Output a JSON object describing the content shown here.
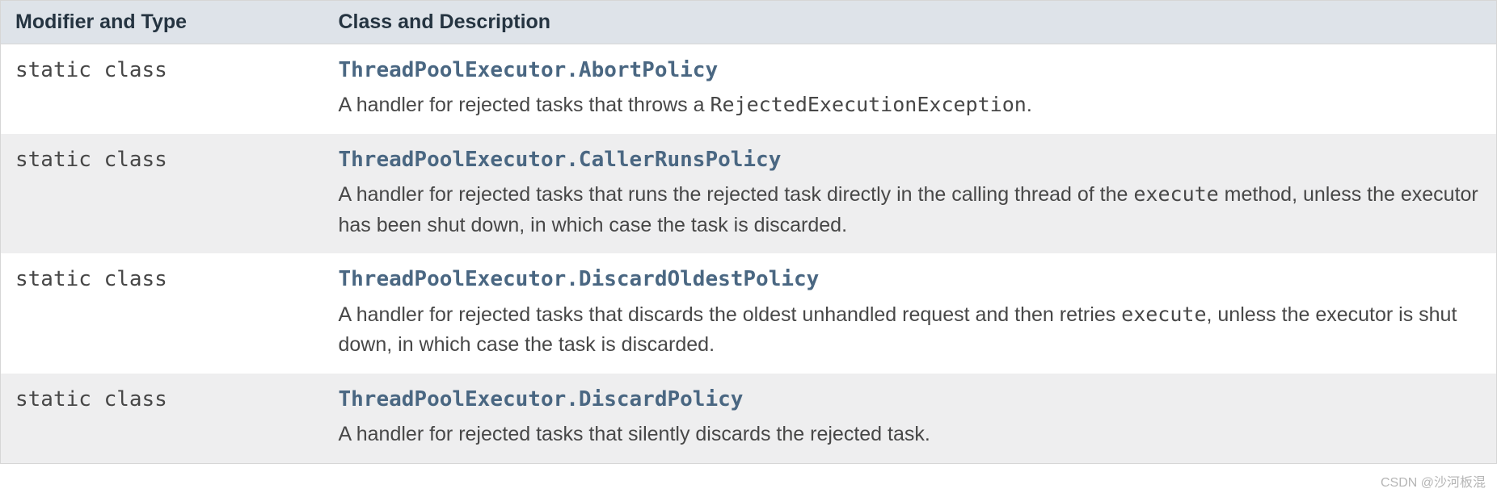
{
  "headers": {
    "modifier": "Modifier and Type",
    "class_desc": "Class and Description"
  },
  "rows": [
    {
      "modifier": "static class ",
      "class_name": "ThreadPoolExecutor.AbortPolicy",
      "desc_pre": "A handler for rejected tasks that throws a ",
      "desc_code": "RejectedExecutionException",
      "desc_post": "."
    },
    {
      "modifier": "static class ",
      "class_name": "ThreadPoolExecutor.CallerRunsPolicy",
      "desc_pre": "A handler for rejected tasks that runs the rejected task directly in the calling thread of the ",
      "desc_code": "execute",
      "desc_post": " method, unless the executor has been shut down, in which case the task is discarded."
    },
    {
      "modifier": "static class ",
      "class_name": "ThreadPoolExecutor.DiscardOldestPolicy",
      "desc_pre": "A handler for rejected tasks that discards the oldest unhandled request and then retries ",
      "desc_code": "execute",
      "desc_post": ", unless the executor is shut down, in which case the task is discarded."
    },
    {
      "modifier": "static class ",
      "class_name": "ThreadPoolExecutor.DiscardPolicy",
      "desc_pre": "A handler for rejected tasks that silently discards the rejected task.",
      "desc_code": "",
      "desc_post": ""
    }
  ],
  "watermark": "CSDN @沙河板混"
}
